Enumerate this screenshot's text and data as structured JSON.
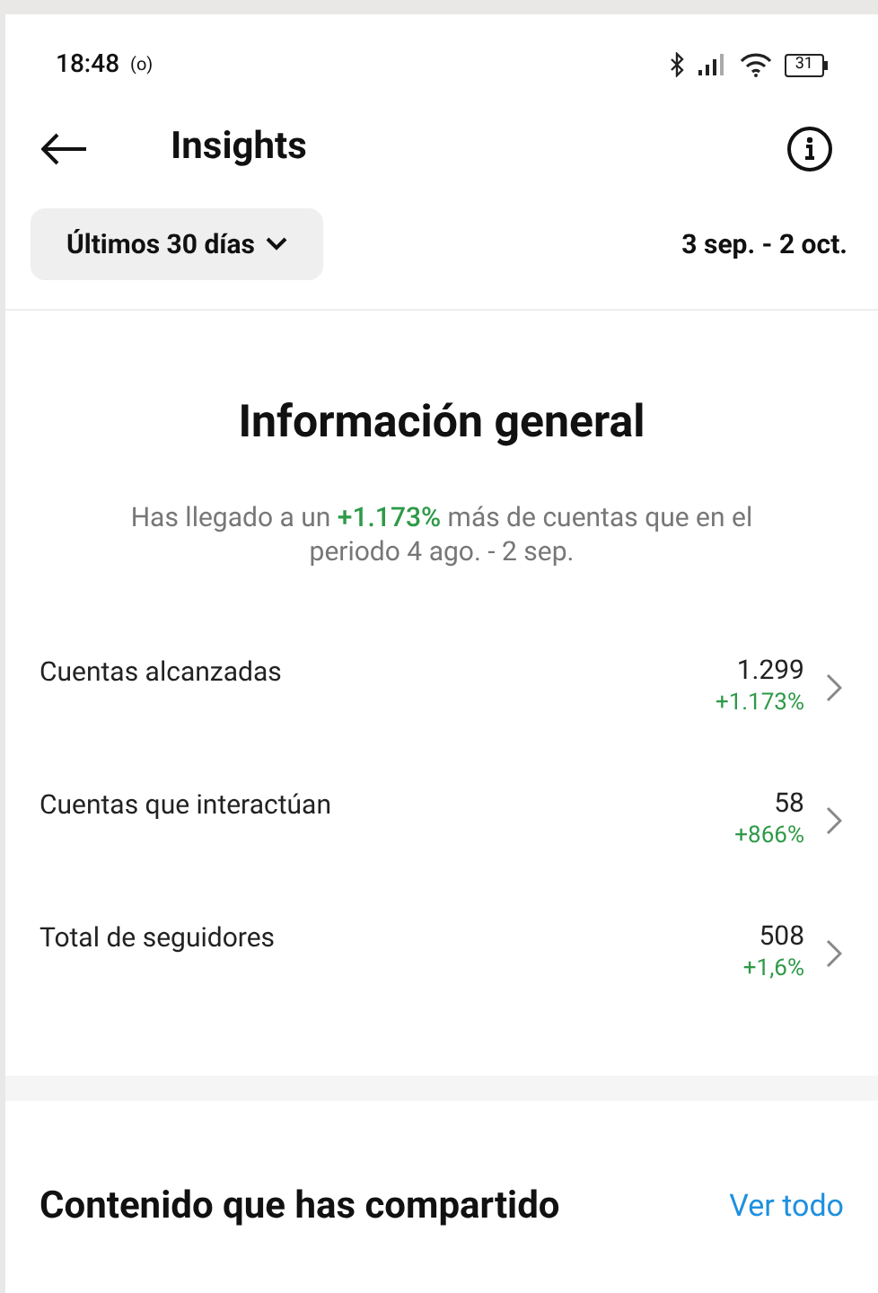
{
  "status_bar": {
    "time": "18:48",
    "hotspot": "(o)",
    "battery": "31"
  },
  "header": {
    "title": "Insights"
  },
  "filter": {
    "label": "Últimos 30 días",
    "date_range": "3 sep. - 2 oct."
  },
  "overview": {
    "title": "Información general",
    "summary": {
      "before": "Has llegado a un ",
      "highlight": "+1.173%",
      "after": " más de cuentas que en el periodo 4 ago. - 2 sep."
    }
  },
  "metrics": [
    {
      "label": "Cuentas alcanzadas",
      "value": "1.299",
      "change": "+1.173%"
    },
    {
      "label": "Cuentas que interactúan",
      "value": "58",
      "change": "+866%"
    },
    {
      "label": "Total de seguidores",
      "value": "508",
      "change": "+1,6%"
    }
  ],
  "shared": {
    "title": "Contenido que has compartido",
    "link": "Ver todo"
  }
}
